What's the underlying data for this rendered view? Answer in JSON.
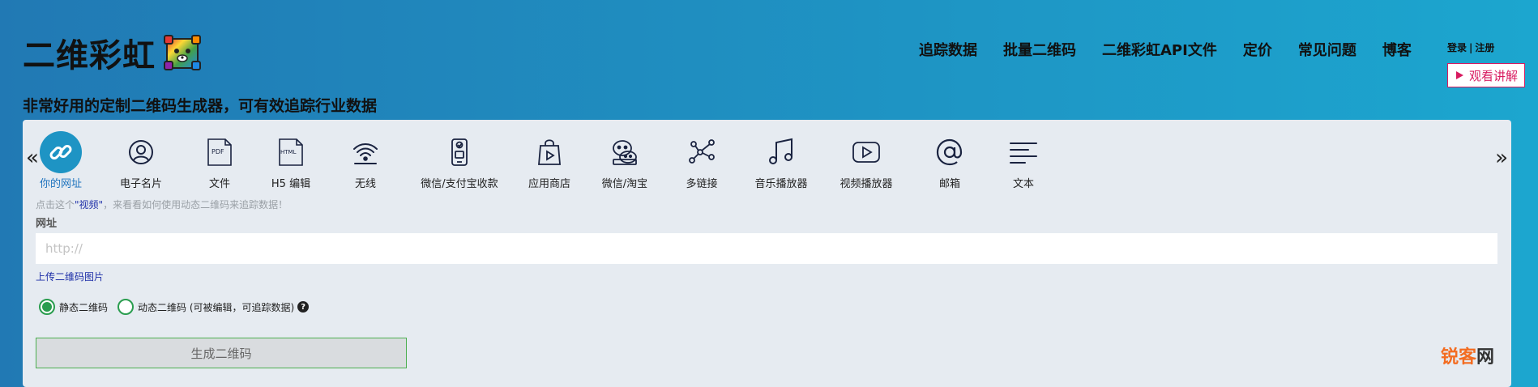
{
  "logo": {
    "text": "二维彩虹"
  },
  "tagline": "非常好用的定制二维码生成器，可有效追踪行业数据",
  "nav": [
    {
      "label": "追踪数据"
    },
    {
      "label": "批量二维码"
    },
    {
      "label": "二维彩虹API文件"
    },
    {
      "label": "定价"
    },
    {
      "label": "常见问题"
    },
    {
      "label": "博客"
    }
  ],
  "auth": {
    "login": "登录",
    "separator": "|",
    "register": "注册"
  },
  "watch_button": {
    "label": "观看讲解",
    "color": "#d81b60"
  },
  "types": [
    {
      "label": "你的网址",
      "icon": "link-icon",
      "active": true
    },
    {
      "label": "电子名片",
      "icon": "person-icon"
    },
    {
      "label": "文件",
      "icon": "pdf-file-icon"
    },
    {
      "label": "H5 编辑",
      "icon": "html-file-icon"
    },
    {
      "label": "无线",
      "icon": "wifi-icon"
    },
    {
      "label": "微信/支付宝收款",
      "icon": "payment-icon"
    },
    {
      "label": "应用商店",
      "icon": "app-store-icon"
    },
    {
      "label": "微信/淘宝",
      "icon": "wechat-icon"
    },
    {
      "label": "多链接",
      "icon": "multi-link-icon"
    },
    {
      "label": "音乐播放器",
      "icon": "music-icon"
    },
    {
      "label": "视频播放器",
      "icon": "video-icon"
    },
    {
      "label": "邮箱",
      "icon": "at-icon"
    },
    {
      "label": "文本",
      "icon": "text-icon"
    }
  ],
  "hint": {
    "before": "点击这个",
    "link": "\"视频\"",
    "after": "，来看看如何使用动态二维码来追踪数据！"
  },
  "url": {
    "label": "网址",
    "placeholder": "http://",
    "value": ""
  },
  "upload_link": "上传二维码图片",
  "radios": {
    "static": {
      "label": "静态二维码",
      "checked": true
    },
    "dynamic": {
      "label": "动态二维码 (可被编辑，可追踪数据)",
      "checked": false
    }
  },
  "help_symbol": "?",
  "generate_button": "生成二维码",
  "arrows": {
    "left": "«",
    "right": "»"
  },
  "brand": {
    "part1": "锐客",
    "part2": "网"
  },
  "colors": {
    "accent": "#1e94c4",
    "green": "#2a9d4f",
    "link": "#1e2fa8"
  }
}
